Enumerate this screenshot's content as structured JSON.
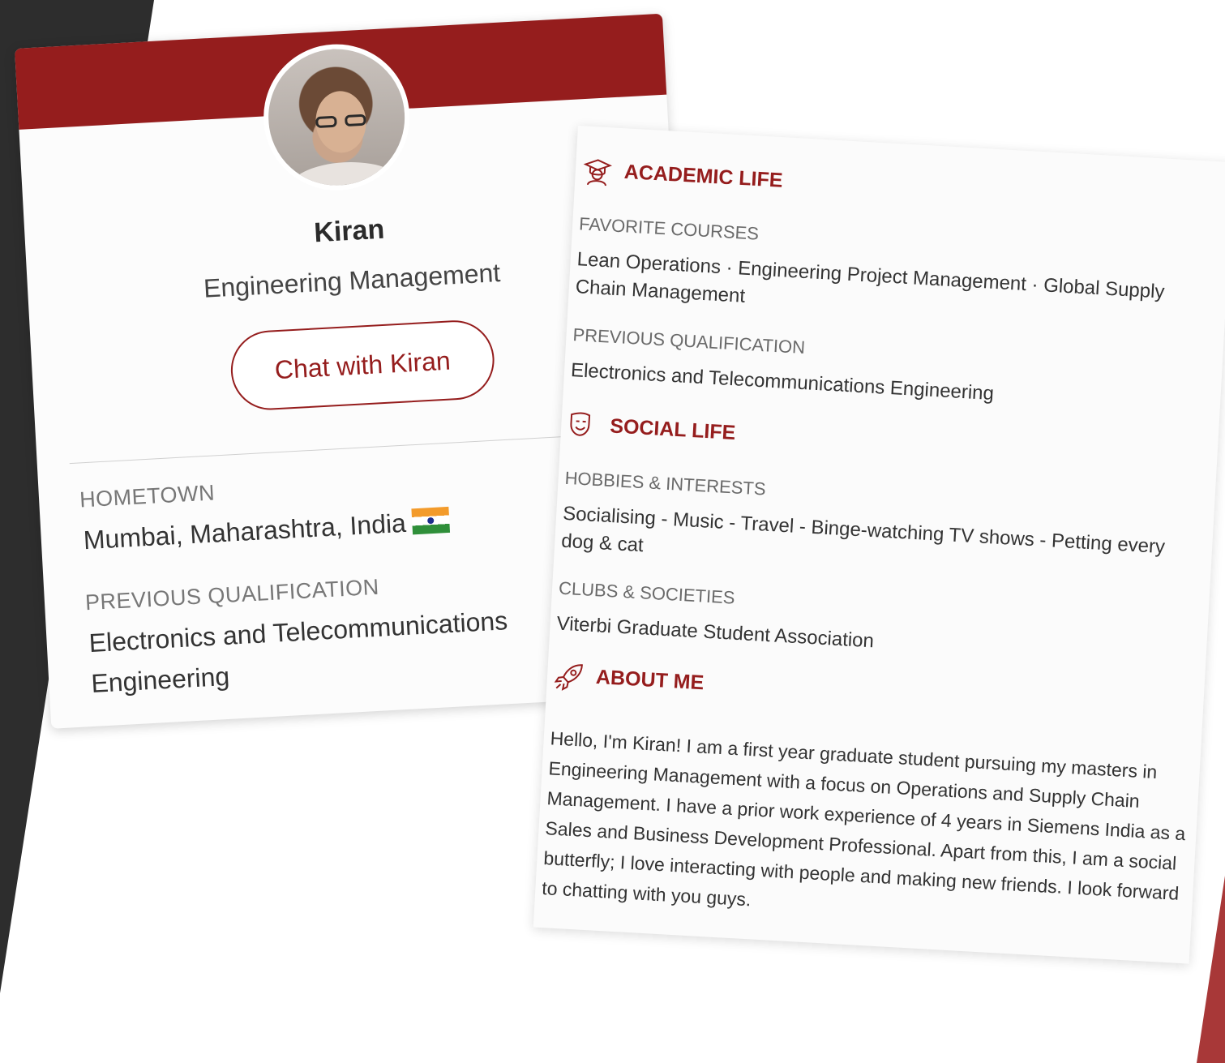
{
  "profile": {
    "name": "Kiran",
    "program": "Engineering Management",
    "chat_label": "Chat with Kiran",
    "hometown_label": "HOMETOWN",
    "hometown": "Mumbai, Maharashtra, India",
    "hometown_flag": "india-flag-icon",
    "prev_qual_label": "PREVIOUS QUALIFICATION",
    "prev_qual": "Electronics and Telecommunications Engineering"
  },
  "academic": {
    "title": "ACADEMIC LIFE",
    "icon": "graduate-icon",
    "fav_courses_label": "FAVORITE COURSES",
    "fav_courses": "Lean Operations · Engineering Project Management · Global Supply Chain Management",
    "prev_qual_label": "PREVIOUS QUALIFICATION",
    "prev_qual": "Electronics and Telecommunications Engineering"
  },
  "social": {
    "title": "SOCIAL LIFE",
    "icon": "theater-mask-icon",
    "hobbies_label": "HOBBIES & INTERESTS",
    "hobbies": "Socialising - Music - Travel - Binge-watching TV shows - Petting every dog & cat",
    "clubs_label": "CLUBS & SOCIETIES",
    "clubs": "Viterbi Graduate Student Association"
  },
  "about": {
    "title": "ABOUT ME",
    "icon": "rocket-icon",
    "text": "Hello, I'm Kiran! I am a first year graduate student pursuing my masters in Engineering Management with a focus on Operations and Supply Chain Management. I have a prior work experience of 4 years in Siemens India as a Sales and Business Development Professional. Apart from this, I am a social butterfly; I love interacting with people and making new friends. I look forward to chatting with you guys."
  },
  "colors": {
    "brand_red": "#951d1d",
    "dark_bg": "#2d2d2d",
    "accent_red": "#a83838"
  }
}
